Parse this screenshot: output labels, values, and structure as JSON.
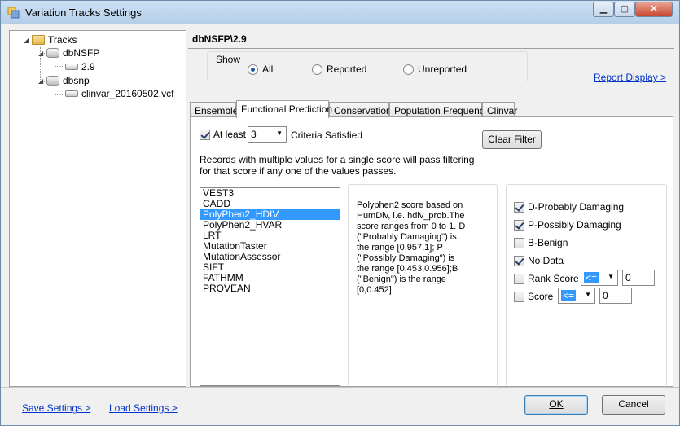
{
  "window": {
    "title": "Variation Tracks Settings"
  },
  "tree": {
    "root": "Tracks",
    "nodes": [
      {
        "label": "dbNSFP",
        "children": [
          "2.9"
        ]
      },
      {
        "label": "dbsnp",
        "children": [
          "clinvar_20160502.vcf"
        ]
      }
    ]
  },
  "panel_title": "dbNSFP\\2.9",
  "show": {
    "label": "Show",
    "options": [
      "All",
      "Reported",
      "Unreported"
    ],
    "selected": "All"
  },
  "report_display_link": "Report Display >",
  "tabs": [
    "Ensemble",
    "Functional Prediction",
    "Conservation",
    "Population Frequency",
    "Clinvar"
  ],
  "active_tab": "Functional Prediction",
  "criteria": {
    "at_least_label": "At least",
    "at_least_checked": true,
    "count": "3",
    "satisfied_label": "Criteria Satisfied"
  },
  "clear_filter_button": "Clear Filter",
  "records_note": "Records with multiple values for a single score will pass filtering for that score if any one of the values passes.",
  "scores": [
    "VEST3",
    "CADD",
    "PolyPhen2_HDIV",
    "PolyPhen2_HVAR",
    "LRT",
    "MutationTaster",
    "MutationAssessor",
    "SIFT",
    "FATHMM",
    "PROVEAN"
  ],
  "selected_score": "PolyPhen2_HDIV",
  "description": "Polyphen2 score based on HumDiv, i.e. hdiv_prob.The score ranges from 0 to 1. D (\"Probably Damaging\") is the range [0.957,1]; P (\"Possibly Damaging\") is the range [0.453,0.956];B (\"Benign\") is the range [0,0.452];",
  "filters": {
    "d_probably_damaging": {
      "label": "D-Probably Damaging",
      "checked": true
    },
    "p_possibly_damaging": {
      "label": "P-Possibly Damaging",
      "checked": true
    },
    "b_benign": {
      "label": "B-Benign",
      "checked": false
    },
    "no_data": {
      "label": "No Data",
      "checked": true
    },
    "rank_score": {
      "label": "Rank Score",
      "checked": false,
      "operator": "<=",
      "value": "0"
    },
    "score": {
      "label": "Score",
      "checked": false,
      "operator": "<=",
      "value": "0"
    }
  },
  "footer": {
    "save_settings": "Save Settings >",
    "load_settings": "Load Settings >",
    "ok": "OK",
    "cancel": "Cancel"
  }
}
